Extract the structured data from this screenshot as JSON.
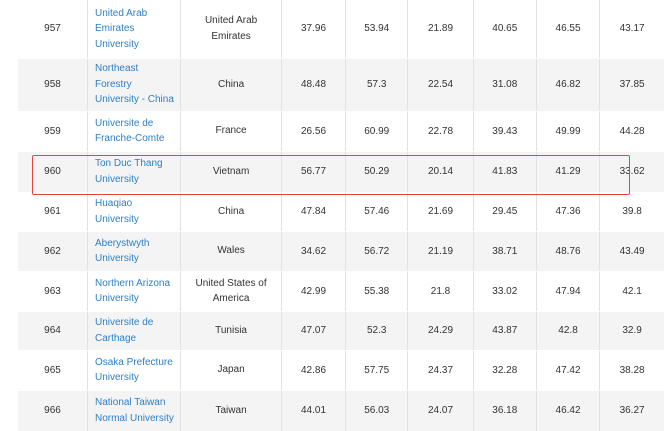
{
  "table": {
    "rows": [
      {
        "rank": "957",
        "university_lines": [
          "United Arab",
          "Emirates",
          "University"
        ],
        "country_lines": [
          "United Arab",
          "Emirates"
        ],
        "scores": [
          "37.96",
          "53.94",
          "21.89",
          "40.65",
          "46.55",
          "43.17"
        ]
      },
      {
        "rank": "958",
        "university_lines": [
          "Northeast",
          "Forestry",
          "University - China"
        ],
        "country_lines": [
          "China"
        ],
        "scores": [
          "48.48",
          "57.3",
          "22.54",
          "31.08",
          "46.82",
          "37.85"
        ]
      },
      {
        "rank": "959",
        "university_lines": [
          "Universite de",
          "Franche-Comte"
        ],
        "country_lines": [
          "France"
        ],
        "scores": [
          "26.56",
          "60.99",
          "22.78",
          "39.43",
          "49.99",
          "44.28"
        ]
      },
      {
        "rank": "960",
        "university_lines": [
          "Ton Duc Thang",
          "University"
        ],
        "country_lines": [
          "Vietnam"
        ],
        "scores": [
          "56.77",
          "50.29",
          "20.14",
          "41.83",
          "41.29",
          "33.62"
        ],
        "highlighted": true
      },
      {
        "rank": "961",
        "university_lines": [
          "Huaqiao",
          "University"
        ],
        "country_lines": [
          "China"
        ],
        "scores": [
          "47.84",
          "57.46",
          "21.69",
          "29.45",
          "47.36",
          "39.8"
        ]
      },
      {
        "rank": "962",
        "university_lines": [
          "Aberystwyth",
          "University"
        ],
        "country_lines": [
          "Wales"
        ],
        "scores": [
          "34.62",
          "56.72",
          "21.19",
          "38.71",
          "48.76",
          "43.49"
        ]
      },
      {
        "rank": "963",
        "university_lines": [
          "Northern Arizona",
          "University"
        ],
        "country_lines": [
          "United States of",
          "America"
        ],
        "scores": [
          "42.99",
          "55.38",
          "21.8",
          "33.02",
          "47.94",
          "42.1"
        ]
      },
      {
        "rank": "964",
        "university_lines": [
          "Universite de",
          "Carthage"
        ],
        "country_lines": [
          "Tunisia"
        ],
        "scores": [
          "47.07",
          "52.3",
          "24.29",
          "43.87",
          "42.8",
          "32.9"
        ]
      },
      {
        "rank": "965",
        "university_lines": [
          "Osaka Prefecture",
          "University"
        ],
        "country_lines": [
          "Japan"
        ],
        "scores": [
          "42.86",
          "57.75",
          "24.37",
          "32.28",
          "47.42",
          "38.28"
        ]
      },
      {
        "rank": "966",
        "university_lines": [
          "National Taiwan",
          "Normal University"
        ],
        "country_lines": [
          "Taiwan"
        ],
        "scores": [
          "44.01",
          "56.03",
          "24.07",
          "36.18",
          "46.42",
          "36.27"
        ]
      }
    ]
  },
  "colors": {
    "link": "#2e7fc6",
    "highlight_border": "#e0483f",
    "stripe": "#f4f4f5"
  }
}
